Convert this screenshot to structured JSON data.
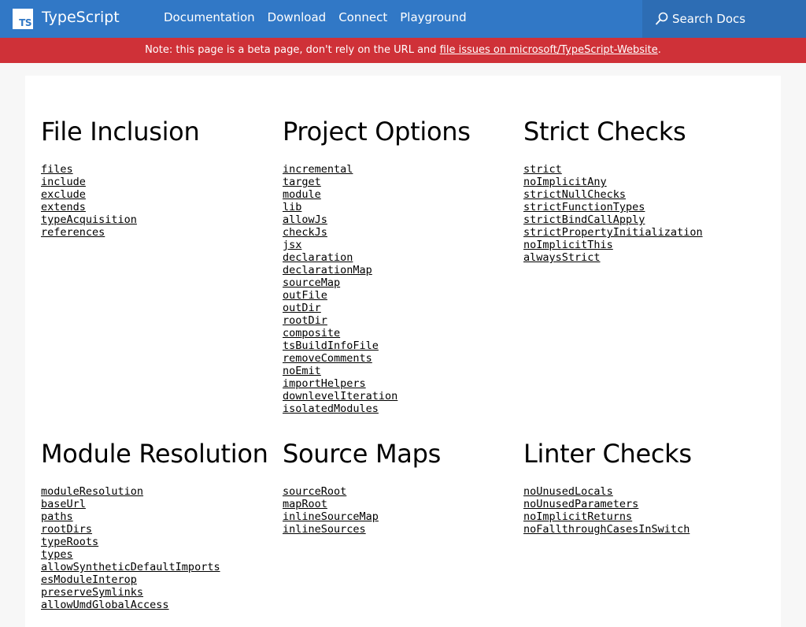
{
  "header": {
    "logo_text": "TS",
    "brand": "TypeScript",
    "nav": [
      "Documentation",
      "Download",
      "Connect",
      "Playground"
    ],
    "search_label": "Search Docs"
  },
  "banner": {
    "text": "Note: this page is a beta page, don't rely on the URL and",
    "link_text": "file issues on microsoft/TypeScript-Website",
    "suffix": "."
  },
  "sections": {
    "file_inclusion": {
      "title": "File Inclusion",
      "items": [
        "files",
        "include",
        "exclude",
        "extends",
        "typeAcquisition",
        "references"
      ]
    },
    "project_options": {
      "title": "Project Options",
      "items": [
        "incremental",
        "target",
        "module",
        "lib",
        "allowJs",
        "checkJs",
        "jsx",
        "declaration",
        "declarationMap",
        "sourceMap",
        "outFile",
        "outDir",
        "rootDir",
        "composite",
        "tsBuildInfoFile",
        "removeComments",
        "noEmit",
        "importHelpers",
        "downlevelIteration",
        "isolatedModules"
      ]
    },
    "strict_checks": {
      "title": "Strict Checks",
      "items": [
        "strict",
        "noImplicitAny",
        "strictNullChecks",
        "strictFunctionTypes",
        "strictBindCallApply",
        "strictPropertyInitialization",
        "noImplicitThis",
        "alwaysStrict"
      ]
    },
    "module_resolution": {
      "title": "Module Resolution",
      "items": [
        "moduleResolution",
        "baseUrl",
        "paths",
        "rootDirs",
        "typeRoots",
        "types",
        "allowSyntheticDefaultImports",
        "esModuleInterop",
        "preserveSymlinks",
        "allowUmdGlobalAccess"
      ]
    },
    "source_maps": {
      "title": "Source Maps",
      "items": [
        "sourceRoot",
        "mapRoot",
        "inlineSourceMap",
        "inlineSources"
      ]
    },
    "linter_checks": {
      "title": "Linter Checks",
      "items": [
        "noUnusedLocals",
        "noUnusedParameters",
        "noImplicitReturns",
        "noFallthroughCasesInSwitch"
      ]
    }
  },
  "colors": {
    "nav_bg": "#3178c6",
    "search_bg": "#2d6db4",
    "banner_bg": "#cf3138"
  }
}
